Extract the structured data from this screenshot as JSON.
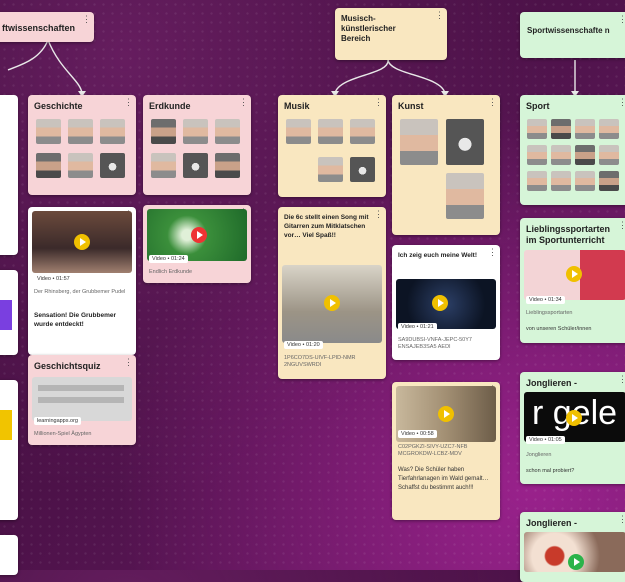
{
  "colors": {
    "background": "#4a1146",
    "pink_card": "#f7d4d7",
    "yellow_card": "#f9e7c0",
    "green_card": "#d6f5d8",
    "play_button": "#f0c000"
  },
  "headers": {
    "left": "ftwissenschaften",
    "middle": "Musisch-künstlerischer Bereich",
    "right": "Sportwissenschafte n"
  },
  "cards": {
    "geschichte": {
      "title": "Geschichte"
    },
    "erdkunde": {
      "title": "Erdkunde"
    },
    "musik": {
      "title": "Musik"
    },
    "kunst": {
      "title": "Kunst"
    },
    "sport": {
      "title": "Sport"
    },
    "gesch_video": {
      "badge": "Video • 01:57",
      "meta": "Der Rhinsberg, der Grubbemer Pudel",
      "text": "Sensation! Die Grubbemer wurde entdeckt!"
    },
    "erdkunde_video": {
      "badge": "Video • 01:24",
      "meta": "Endlich Erdkunde"
    },
    "musik_video": {
      "title": "Die 6c stellt einen Song mit Gitarren zum Mitklatschen vor… Viel Spaß!!",
      "badge": "Video • 01:20",
      "meta": "1P6CO7DS-UIVF-LPID-NMR 2NGUVSWRDI"
    },
    "kunst_video1": {
      "title": "Ich zeig euch meine Welt!",
      "badge": "Video • 01:21",
      "meta": "SA9DUBSI-VNFA-JEPC-50Y7 ENSAJEB3SA5 AEDI"
    },
    "kunst_video2": {
      "badge": "Video • 00:58",
      "meta": "C02PGKZI-SIVY-UZC7-NFB MCGROKDW-LCBZ-MDV",
      "text": "Was? Die Schüler haben Tierfahrlanagen im Wald gemalt… Schaffst du bestimmt auch!!!"
    },
    "geschichtsquiz": {
      "title": "Geschichtsquiz",
      "badge": "learningapps.org",
      "meta": "Millionen-Spiel Ägypten"
    },
    "lieblingssport": {
      "title": "Lieblingssportarten im Sportunterricht",
      "badge": "Video • 01:34",
      "meta": "Lieblingssportarten",
      "text": "von unseren Schüler/innen"
    },
    "jonglieren1": {
      "title": "Jonglieren -",
      "badge": "Video • 01:05",
      "meta": "Jonglieren",
      "text": "schon mal probiert?"
    },
    "jonglieren2": {
      "title": "Jonglieren -"
    }
  }
}
